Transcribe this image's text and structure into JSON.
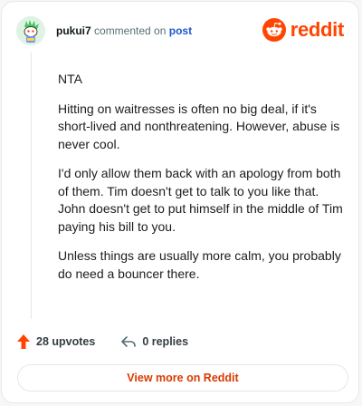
{
  "header": {
    "username": "pukui7",
    "action_text": "commented on",
    "post_link": "post",
    "brand_name": "reddit",
    "brand_color": "#ff4500"
  },
  "comment": {
    "paragraphs": [
      "NTA",
      "Hitting on waitresses is often no big deal, if it's short-lived and nonthreatening. However, abuse is never cool.",
      "I'd only allow them back with an apology from both of them. Tim doesn't get to talk to you like that. John doesn't get to put himself in the middle of Tim paying his bill to you.",
      "Unless things are usually more calm, you probably do need a bouncer there."
    ]
  },
  "actions": {
    "upvotes": "28 upvotes",
    "replies": "0 replies",
    "upvote_icon": "upvote-arrow-icon",
    "reply_icon": "reply-arrow-icon"
  },
  "footer": {
    "view_more": "View more on Reddit",
    "accent_color": "#d93a00"
  }
}
